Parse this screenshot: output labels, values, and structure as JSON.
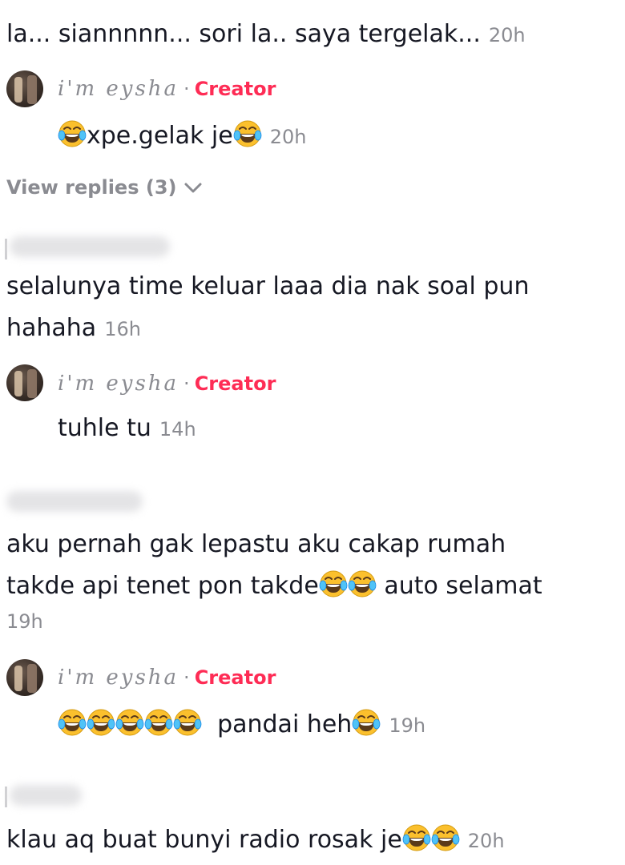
{
  "comments": [
    {
      "text": "la... siannnnn... sori la.. saya tergelak...",
      "time": "20h",
      "reply": {
        "author": "i'm eysha",
        "badge": "Creator",
        "text": "xpe.gelak je",
        "time": "20h"
      },
      "view_replies": "View replies (3)"
    },
    {
      "text_line1": "selalunya time keluar laaa dia nak soal pun",
      "text_line2": "hahaha",
      "time": "16h",
      "reply": {
        "author": "i'm eysha",
        "badge": "Creator",
        "text": "tuhle tu",
        "time": "14h"
      }
    },
    {
      "text_line1": "aku pernah gak lepastu aku cakap rumah",
      "text_line2a": "takde api tenet pon takde",
      "text_line2b": "auto selamat",
      "time": "19h",
      "reply": {
        "author": "i'm eysha",
        "badge": "Creator",
        "text": "pandai heh",
        "time": "19h"
      }
    },
    {
      "text": "klau aq buat bunyi radio rosak je",
      "time": "20h"
    }
  ],
  "icons": {
    "emoji": "face-with-tears-of-joy-icon",
    "chevron": "chevron-down-icon"
  },
  "colors": {
    "creator_badge": "#fe2c55",
    "meta": "#8a8b91",
    "text": "#161823",
    "emoji_face": "#fbc02d"
  }
}
